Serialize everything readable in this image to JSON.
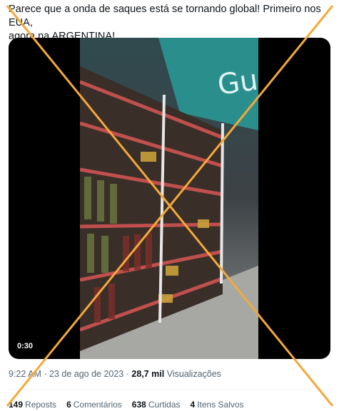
{
  "tweet": {
    "text": "Parece que a onda de saques está se tornando global! Primeiro nos EUA,\nagora na ARGENTINA!"
  },
  "media": {
    "duration": "0:30",
    "store_sign_text": "Gu"
  },
  "meta": {
    "time": "9:22 AM",
    "separator1": " · ",
    "date": "23 de ago de 2023",
    "separator2": " · ",
    "views_count": "28,7 mil",
    "views_label": "Visualizações"
  },
  "stats": {
    "reposts_count": "149",
    "reposts_label": "Reposts",
    "comments_count": "6",
    "comments_label": "Comentários",
    "likes_count": "638",
    "likes_label": "Curtidas",
    "saves_count": "4",
    "saves_label": "Itens Salvos"
  },
  "colors": {
    "cross": "#f4a93a",
    "shelf_red": "#c0504d",
    "sign_teal": "#2a8f8c"
  }
}
